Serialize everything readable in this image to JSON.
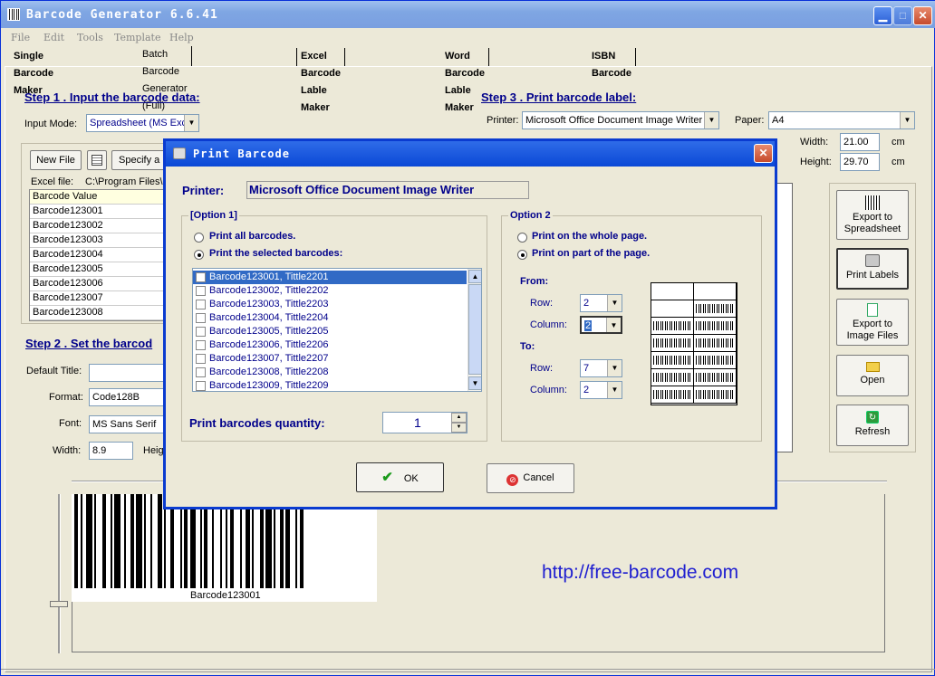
{
  "window": {
    "title": "Barcode Generator  6.6.41"
  },
  "menu": [
    "File",
    "Edit",
    "Tools",
    "Template",
    "Help"
  ],
  "tabs": [
    "Single Barcode Maker",
    "Batch Barcode Generator (Full)",
    "Excel Barcode Lable Maker",
    "Word Barcode Lable Maker",
    "ISBN Barcode"
  ],
  "step1": {
    "heading": "Step 1 .  Input the barcode data:",
    "input_mode_label": "Input Mode:",
    "input_mode_value": "Spreadsheet (MS Exc",
    "new_file": "New File",
    "specify": "Specify a F",
    "excel_file_label": "Excel file:",
    "excel_file_value": "C:\\Program Files\\E",
    "grid_header": "Barcode Value",
    "grid_rows": [
      "Barcode123001",
      "Barcode123002",
      "Barcode123003",
      "Barcode123004",
      "Barcode123005",
      "Barcode123006",
      "Barcode123007",
      "Barcode123008"
    ]
  },
  "step2": {
    "heading": "Step 2 . Set the barcod",
    "default_title_label": "Default Title:",
    "format_label": "Format:",
    "format_value": "Code128B",
    "font_label": "Font:",
    "font_value": "MS Sans Serif",
    "width_label": "Width:",
    "width_value": "8.9",
    "height_label": "Heig"
  },
  "step3": {
    "heading": "Step 3 . Print barcode label:",
    "printer_label": "Printer:",
    "printer_value": "Microsoft Office Document Image Writer",
    "paper_label": "Paper:",
    "paper_value": "A4",
    "width_label": "Width:",
    "width_value": "21.00",
    "width_unit": "cm",
    "height_label": "Height:",
    "height_value": "29.70",
    "height_unit": "cm"
  },
  "side_buttons": [
    "Export to Spreadsheet",
    "Print Labels",
    "Export to Image Files",
    "Open",
    "Refresh"
  ],
  "preview": {
    "caption": "Barcode123001",
    "url": "http://free-barcode.com"
  },
  "dialog": {
    "title": "Print Barcode",
    "printer_label": "Printer:",
    "printer_value": "Microsoft Office Document Image Writer",
    "option1_label": "[Option 1]",
    "print_all": "Print all barcodes.",
    "print_selected": "Print the selected barcodes:",
    "list": [
      "Barcode123001,  Tittle2201",
      "Barcode123002,  Tittle2202",
      "Barcode123003,  Tittle2203",
      "Barcode123004,  Tittle2204",
      "Barcode123005,  Tittle2205",
      "Barcode123006,  Tittle2206",
      "Barcode123007,  Tittle2207",
      "Barcode123008,  Tittle2208",
      "Barcode123009,  Tittle2209"
    ],
    "quantity_label": "Print barcodes quantity:",
    "quantity_value": "1",
    "option2_label": "Option 2",
    "whole_page": "Print on the whole page.",
    "part_page": "Print on part of the page.",
    "from_label": "From:",
    "to_label": "To:",
    "row_label": "Row:",
    "column_label": "Column:",
    "from_row": "2",
    "from_col": "2",
    "to_row": "7",
    "to_col": "2",
    "ok": "OK",
    "cancel": "Cancel"
  }
}
